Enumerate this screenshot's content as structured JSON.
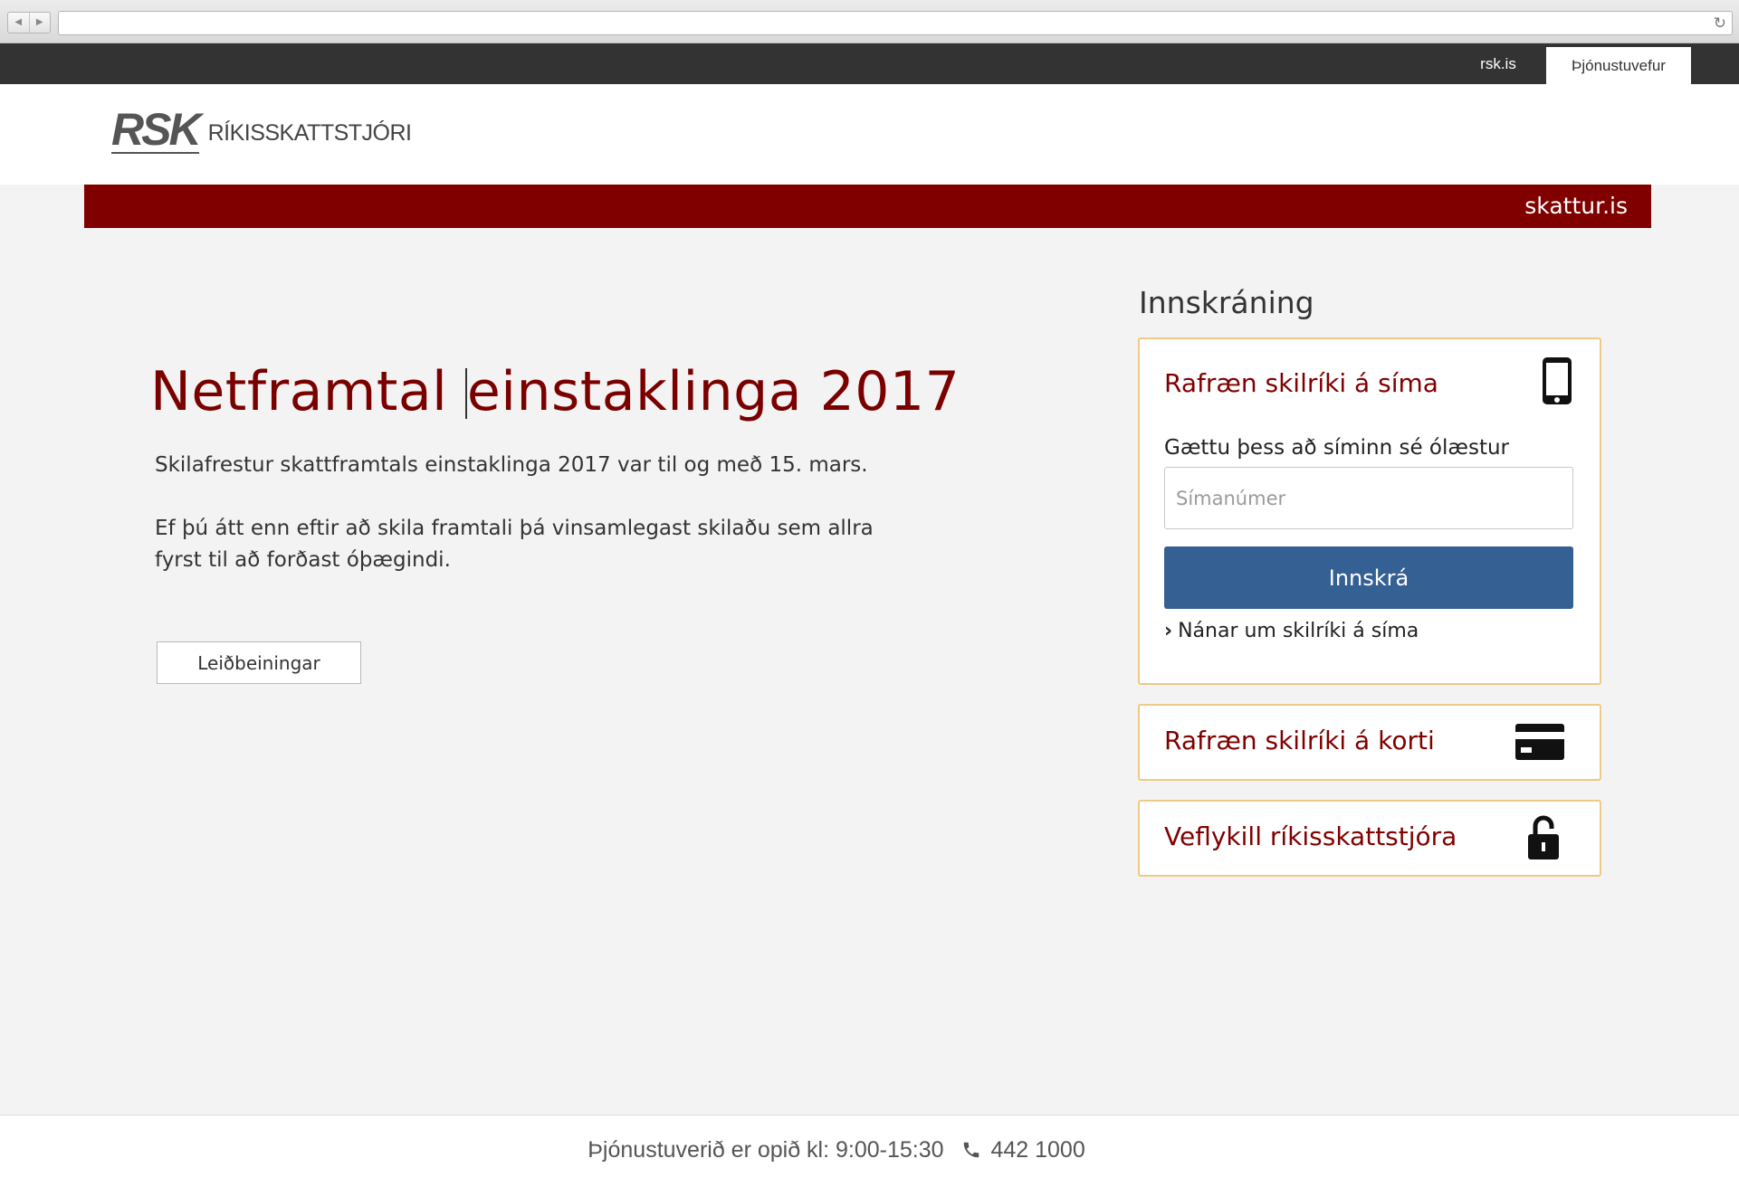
{
  "browser": {
    "reload_glyph": "↻"
  },
  "topbar": {
    "links": [
      "rsk.is",
      "Þjónustuvefur"
    ]
  },
  "header": {
    "logo_mark": "RSK",
    "logo_name": "RÍKISSKATTSTJÓRI"
  },
  "band": {
    "site": "skattur.is"
  },
  "main": {
    "headline_part1": "Netframtal",
    "headline_part2": "einstaklinga 2017",
    "paragraph1": "Skilafrestur skattframtals einstaklinga 2017 var til og með 15. mars.",
    "paragraph2": "Ef þú átt enn eftir að skila framtali þá vinsamlegast skilaðu sem allra fyrst til að forðast óþægindi.",
    "guide_button": "Leiðbeiningar"
  },
  "login": {
    "title": "Innskráning",
    "phone_card": {
      "title": "Rafræn skilríki á síma",
      "icon": "phone-icon",
      "hint": "Gættu þess að síminn sé ólæstur",
      "input_placeholder": "Símanúmer",
      "input_value": "",
      "button": "Innskrá",
      "more_link": "Nánar um skilríki á síma"
    },
    "card_card": {
      "title": "Rafræn skilríki á korti",
      "icon": "credit-card-icon"
    },
    "key_card": {
      "title": "Veflykill ríkisskattstjóra",
      "icon": "unlocked-padlock-icon"
    }
  },
  "footer": {
    "hours": "Þjónustuverið er opið kl: 9:00-15:30",
    "phone": "442 1000"
  },
  "colors": {
    "brand_red": "#800000",
    "button_blue": "#356093",
    "card_border": "#f0c987",
    "topbar": "#333333"
  }
}
